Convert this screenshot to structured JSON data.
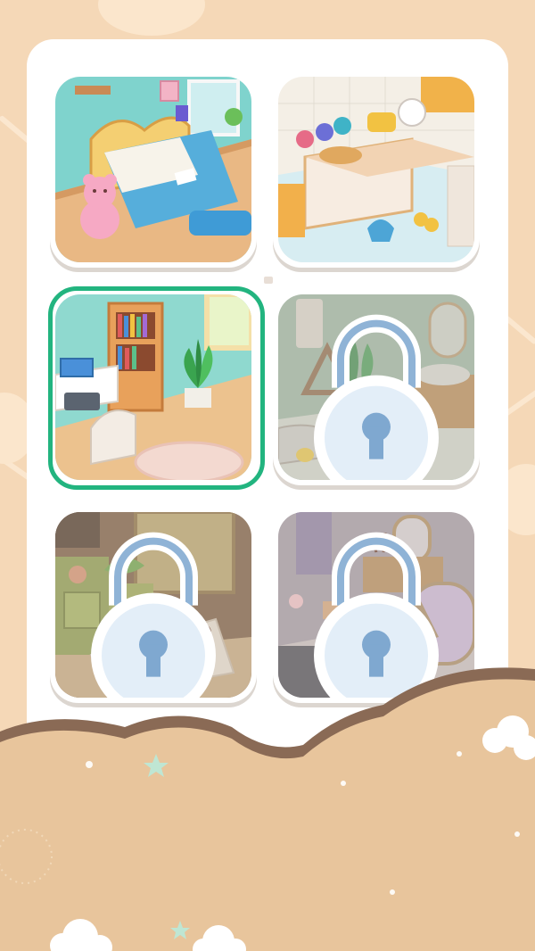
{
  "screen": "room-selection",
  "colors": {
    "background": "#f5d8b7",
    "panel": "#ffffff",
    "selected_ring": "#22b47f",
    "ground": "#e8c59c",
    "ground_edge": "#8a6a55"
  },
  "rooms": [
    {
      "id": "bedroom",
      "state": "unlocked",
      "selected": false
    },
    {
      "id": "kitchen",
      "state": "unlocked",
      "selected": false
    },
    {
      "id": "study",
      "state": "unlocked",
      "selected": true
    },
    {
      "id": "bathroom",
      "state": "locked",
      "selected": false
    },
    {
      "id": "bakery",
      "state": "locked",
      "selected": false
    },
    {
      "id": "dressing-room",
      "state": "locked",
      "selected": false
    }
  ],
  "icons": {
    "lock": "padlock-icon"
  }
}
